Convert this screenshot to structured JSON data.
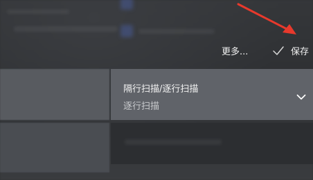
{
  "toolbar": {
    "more_label": "更多...",
    "save_label": "保存"
  },
  "dropdown": {
    "title": "隔行扫描/逐行扫描",
    "selected_value": "逐行扫描"
  },
  "colors": {
    "annotation_arrow": "#e8392c",
    "dropdown_bg": "#606369",
    "background": "#2f3133"
  },
  "icons": {
    "check": "check-icon",
    "chevron": "chevron-down-icon",
    "annotation": "red-arrow-icon"
  }
}
